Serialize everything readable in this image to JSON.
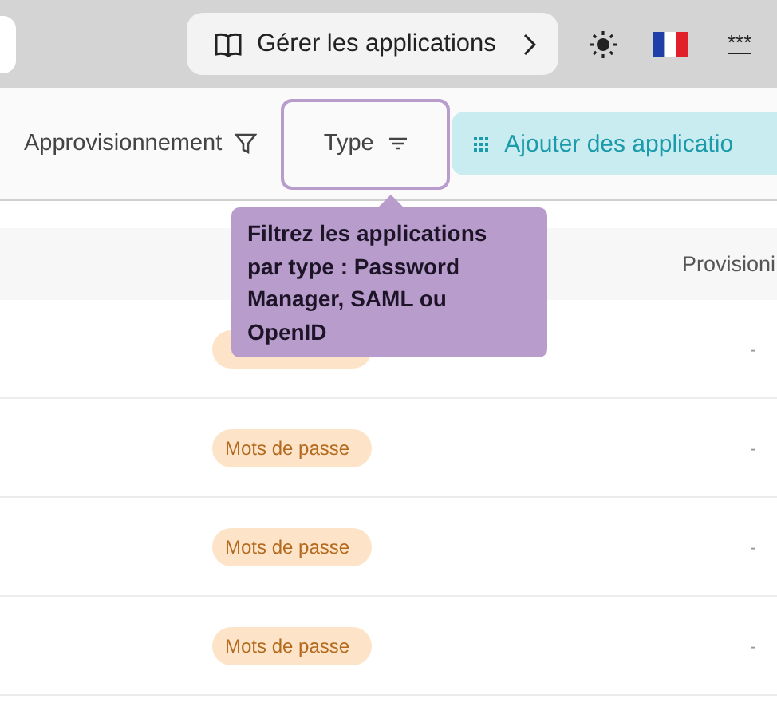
{
  "topbar": {
    "guide_button": "Gérer les applications",
    "menu_label": "***"
  },
  "filters": {
    "provisioning": "Approvisionnement",
    "type": {
      "label": "Type",
      "selected": true
    },
    "add_button": "Ajouter des applicatio"
  },
  "tooltip": "Filtrez les applications par type : Password Manager, SAML ou OpenID",
  "table": {
    "columns": [
      "Provisioni"
    ],
    "rows": [
      {
        "provisioning": "-"
      },
      {
        "tag": "Mots de passe",
        "provisioning": "-"
      },
      {
        "tag": "Mots de passe",
        "provisioning": "-"
      },
      {
        "tag": "Mots de passe",
        "provisioning": "-"
      }
    ]
  }
}
